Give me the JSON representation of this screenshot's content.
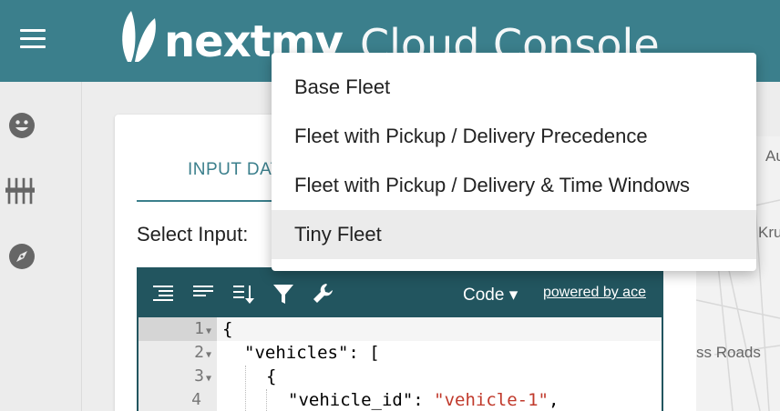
{
  "header": {
    "logo_text": "nextmv",
    "subtitle": "Cloud Console",
    "color": "#3b7f8c"
  },
  "rail": {
    "icons": [
      "smiley-icon",
      "sliders-icon",
      "compass-icon"
    ]
  },
  "tab": {
    "label": "INPUT DATA"
  },
  "select_label": "Select Input:",
  "editor": {
    "mode_label": "Code ▾",
    "powered_by": "powered by ace",
    "line_numbers": [
      "1",
      "2",
      "3",
      "4"
    ],
    "lines": [
      "{",
      "\"vehicles\": [",
      "{",
      "\"vehicle_id\": "
    ],
    "vehicle_value": "\"vehicle-1\"",
    "comma": ","
  },
  "map": {
    "labels": [
      "Au",
      "Kru",
      "ss Roads"
    ]
  },
  "dropdown": {
    "options": [
      "Base Fleet",
      "Fleet with Pickup / Delivery Precedence",
      "Fleet with Pickup / Delivery & Time Windows",
      "Tiny Fleet"
    ],
    "selected_index": 3
  }
}
